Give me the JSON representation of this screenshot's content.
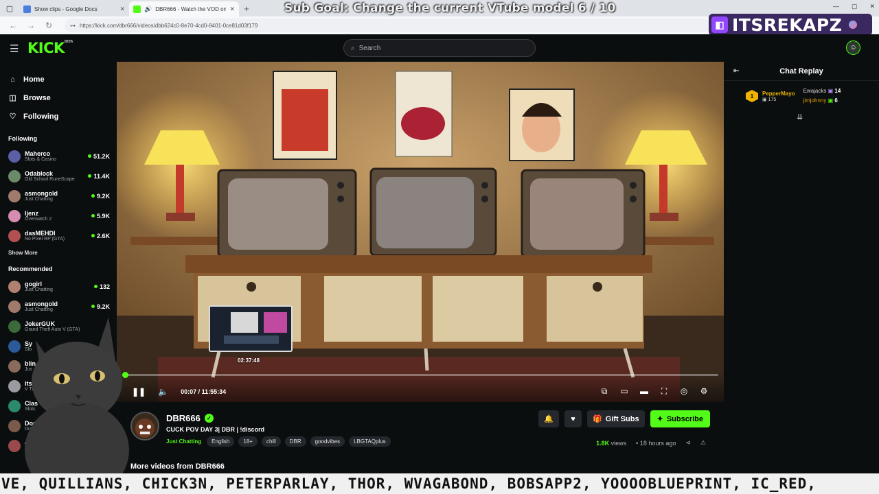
{
  "browser": {
    "tabs": [
      {
        "title": "Show clips - Google Docs",
        "active": false
      },
      {
        "title": "DBR666 - Watch the VOD on Kick",
        "active": true
      }
    ],
    "url": "https://kick.com/dbr666/videos/dbb624c0-8e70-4cd0-8401-0ce81d03f179"
  },
  "overlay": {
    "sub_goal": "Sub Goal: Change the current VTube model  6 / 10",
    "brand_name": "ITSREKAPZ",
    "ticker": "VE, QUILLIANS, CHICK3N, PETERPARLAY, THOR, WVAGABOND, BOBSAPP2, YOOOOBLUEPRINT, IC_RED,"
  },
  "kick": {
    "logo": "KICK",
    "logo_tag": "BETA",
    "search_placeholder": "Search",
    "nav": [
      {
        "label": "Home",
        "icon": "home-icon"
      },
      {
        "label": "Browse",
        "icon": "compass-icon"
      },
      {
        "label": "Following",
        "icon": "heart-icon"
      }
    ],
    "following_title": "Following",
    "following": [
      {
        "name": "Maherco",
        "category": "Slots & Casino",
        "viewers": "51.2K",
        "color": "#5b5fa8"
      },
      {
        "name": "Odablock",
        "category": "Old School RuneScape",
        "viewers": "11.4K",
        "color": "#6a8a6a"
      },
      {
        "name": "asmongold",
        "category": "Just Chatting",
        "viewers": "9.2K",
        "color": "#a07a6a"
      },
      {
        "name": "ljenz",
        "category": "Overwatch 2",
        "viewers": "5.9K",
        "color": "#d58cb0"
      },
      {
        "name": "dasMEHDI",
        "category": "No Pixel RP (GTA)",
        "viewers": "2.6K",
        "color": "#b05050"
      }
    ],
    "show_more": "Show More",
    "recommended_title": "Recommended",
    "recommended": [
      {
        "name": "gogirl",
        "category": "Just Chatting",
        "viewers": "132",
        "color": "#b08070"
      },
      {
        "name": "asmongold",
        "category": "Just Chatting",
        "viewers": "9.2K",
        "color": "#a07a6a"
      },
      {
        "name": "JokerGUK",
        "category": "Grand Theft Auto V (GTA)",
        "viewers": "",
        "color": "#3a6a3a"
      },
      {
        "name": "Sy",
        "category": "Slo",
        "viewers": "",
        "color": "#2a5a9a"
      },
      {
        "name": "blin",
        "category": "Jus",
        "viewers": "",
        "color": "#8a6a5a"
      },
      {
        "name": "itsl",
        "category": "V Ti",
        "viewers": "",
        "color": "#9a9aa0"
      },
      {
        "name": "Clas",
        "category": "Slots",
        "viewers": "",
        "color": "#2a8a6a"
      },
      {
        "name": "Dos",
        "category": "Dur",
        "viewers": "",
        "color": "#7a5a4a"
      },
      {
        "name": "de",
        "category": "IR",
        "viewers": "",
        "color": "#9a4a4a"
      }
    ],
    "player": {
      "time": "00:07 / 11:55:34",
      "preview_time": "02:37:48",
      "progress": 0.001
    },
    "chat": {
      "title": "Chat Replay",
      "gifters": [
        {
          "name": "PepperMayo",
          "count": "175",
          "rank": "1"
        },
        {
          "name": "Ewajacks",
          "count": "14"
        },
        {
          "name": "jimjohnny",
          "count": "6"
        }
      ]
    },
    "stream": {
      "streamer": "DBR666",
      "title": "CUCK POV DAY 3| DBR | !discord",
      "category": "Just Chatting",
      "tags": [
        "English",
        "18+",
        "chill",
        "DBR",
        "goodvibes",
        "LBGTAQplus"
      ],
      "views_value": "1.8K",
      "views_label": "views",
      "ago": "18 hours ago",
      "gift_label": "Gift Subs",
      "subscribe_label": "Subscribe",
      "more_videos": "More videos from DBR666"
    }
  }
}
